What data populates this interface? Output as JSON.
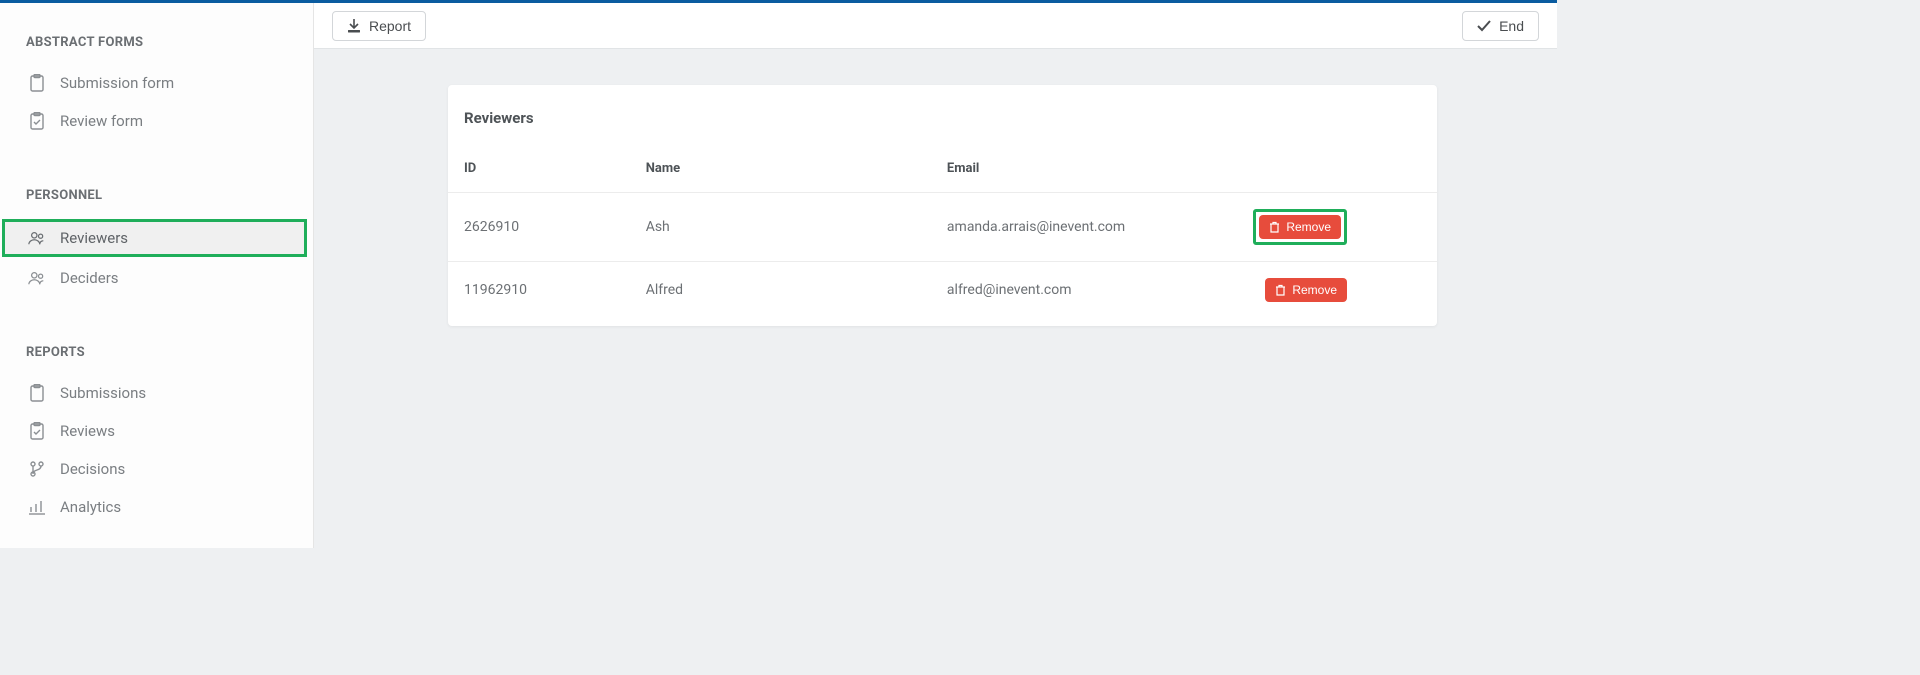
{
  "sidebar": {
    "sections": [
      {
        "heading": "ABSTRACT FORMS",
        "items": [
          {
            "label": "Submission form"
          },
          {
            "label": "Review form"
          }
        ]
      },
      {
        "heading": "PERSONNEL",
        "items": [
          {
            "label": "Reviewers"
          },
          {
            "label": "Deciders"
          }
        ]
      },
      {
        "heading": "REPORTS",
        "items": [
          {
            "label": "Submissions"
          },
          {
            "label": "Reviews"
          },
          {
            "label": "Decisions"
          },
          {
            "label": "Analytics"
          }
        ]
      }
    ]
  },
  "topbar": {
    "report_label": "Report",
    "end_label": "End"
  },
  "panel": {
    "title": "Reviewers",
    "columns": {
      "id": "ID",
      "name": "Name",
      "email": "Email"
    },
    "remove_label": "Remove",
    "rows": [
      {
        "id": "2626910",
        "name": "Ash",
        "email": "amanda.arrais@inevent.com"
      },
      {
        "id": "11962910",
        "name": "Alfred",
        "email": "alfred@inevent.com"
      }
    ]
  }
}
